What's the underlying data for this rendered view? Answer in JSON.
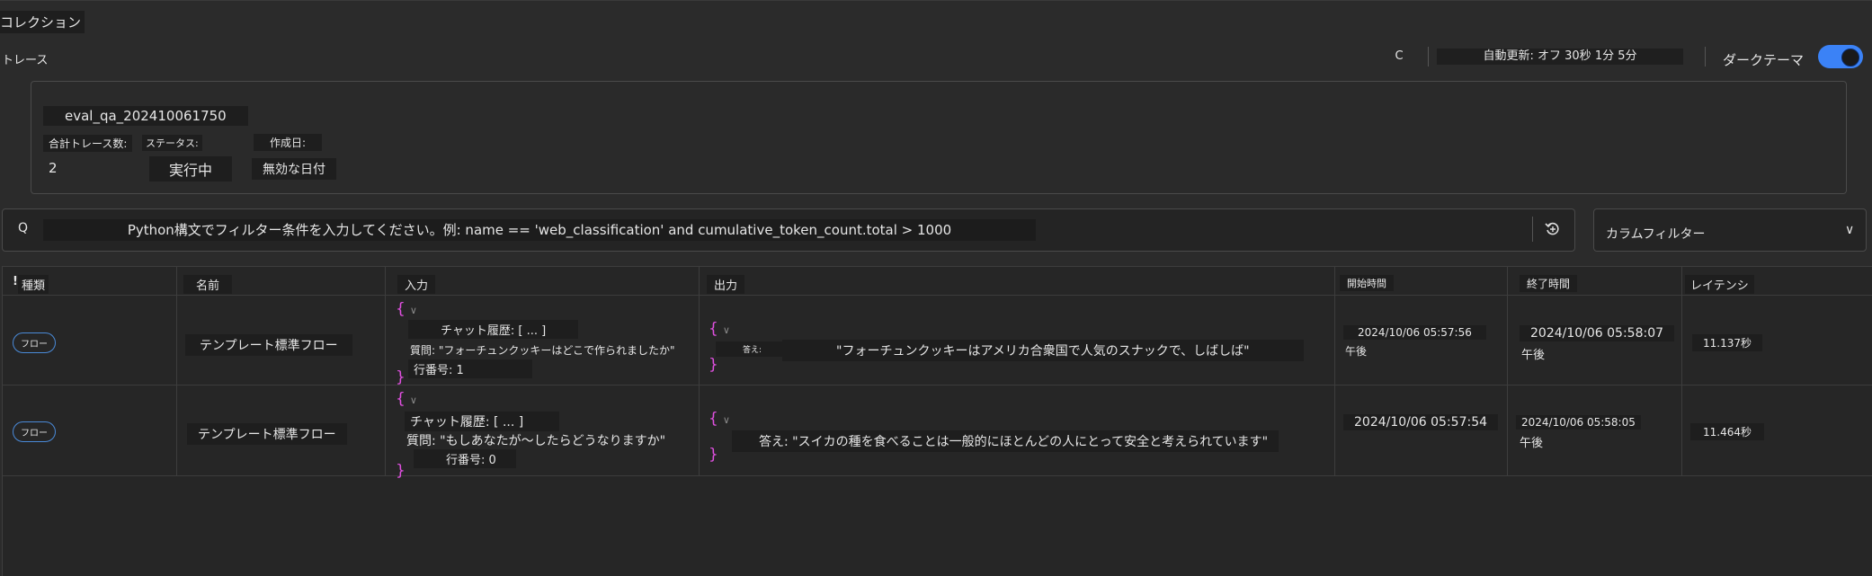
{
  "header": {
    "collection_title": "コレクション",
    "traces_label": "トレース",
    "refresh_icon_text": "C",
    "auto_refresh": "自動更新: オフ 30秒 1分 5分",
    "dark_theme_label": "ダークテーマ",
    "dark_theme_on": true
  },
  "run": {
    "name": "eval_qa_202410061750",
    "total_traces_label": "合計トレース数:",
    "total_traces_value": "2",
    "status_label": "ステータス:",
    "status_value": "実行中",
    "created_label": "作成日:",
    "created_value": "無効な日付"
  },
  "filter": {
    "icon_text": "Q",
    "placeholder": "Python構文でフィルター条件を入力してください。例: name == 'web_classification' and cumulative_token_count.total > 1000",
    "column_filter_label": "カラムフィルター",
    "column_filter_chevron": "∨"
  },
  "table": {
    "columns": [
      "種類",
      "名前",
      "入力",
      "出力",
      "開始時間",
      "終了時間",
      "レイテンシ"
    ],
    "sort_marker": "!",
    "rows": [
      {
        "kind": "フロー",
        "name": "テンプレート標準フロー",
        "input_brace_open": "{",
        "input_chevron": "∨",
        "input_chat_history": "チャット履歴: [ ... ]",
        "input_question": "質問: \"フォーチュンクッキーはどこで作られましたか\"",
        "input_line_number": "行番号: 1",
        "input_brace_close": "}",
        "output_brace_open": "{",
        "output_chevron": "∨",
        "output_key": "答え:",
        "output_answer": "\"フォーチュンクッキーはアメリカ合衆国で人気のスナックで、しばしば\"",
        "output_brace_close": "}",
        "start_date": "2024/10/06 05:57:56",
        "start_ampm": "午後",
        "end_date": "2024/10/06 05:58:07",
        "end_ampm": "午後",
        "latency": "11.137秒"
      },
      {
        "kind": "フロー",
        "name": "テンプレート標準フロー",
        "input_brace_open": "{",
        "input_chevron": "∨",
        "input_chat_history": "チャット履歴: [ ... ]",
        "input_question": "質問: \"もしあなたが〜したらどうなりますか\"",
        "input_line_number": "行番号: 0",
        "input_brace_close": "}",
        "output_brace_open": "{",
        "output_chevron": "∨",
        "output_answer": "答え: \"スイカの種を食べることは一般的にほとんどの人にとって安全と考えられています\"",
        "output_brace_close": "}",
        "start_date": "2024/10/06 05:57:54",
        "start_ampm": "",
        "end_date": "2024/10/06 05:58:05",
        "end_ampm": "午後",
        "latency": "11.464秒"
      }
    ]
  },
  "colors": {
    "background": "#2b2b2b",
    "accent": "#3b82f6",
    "json_brace": "#e050e0",
    "pill_border": "#4a8ad8"
  }
}
